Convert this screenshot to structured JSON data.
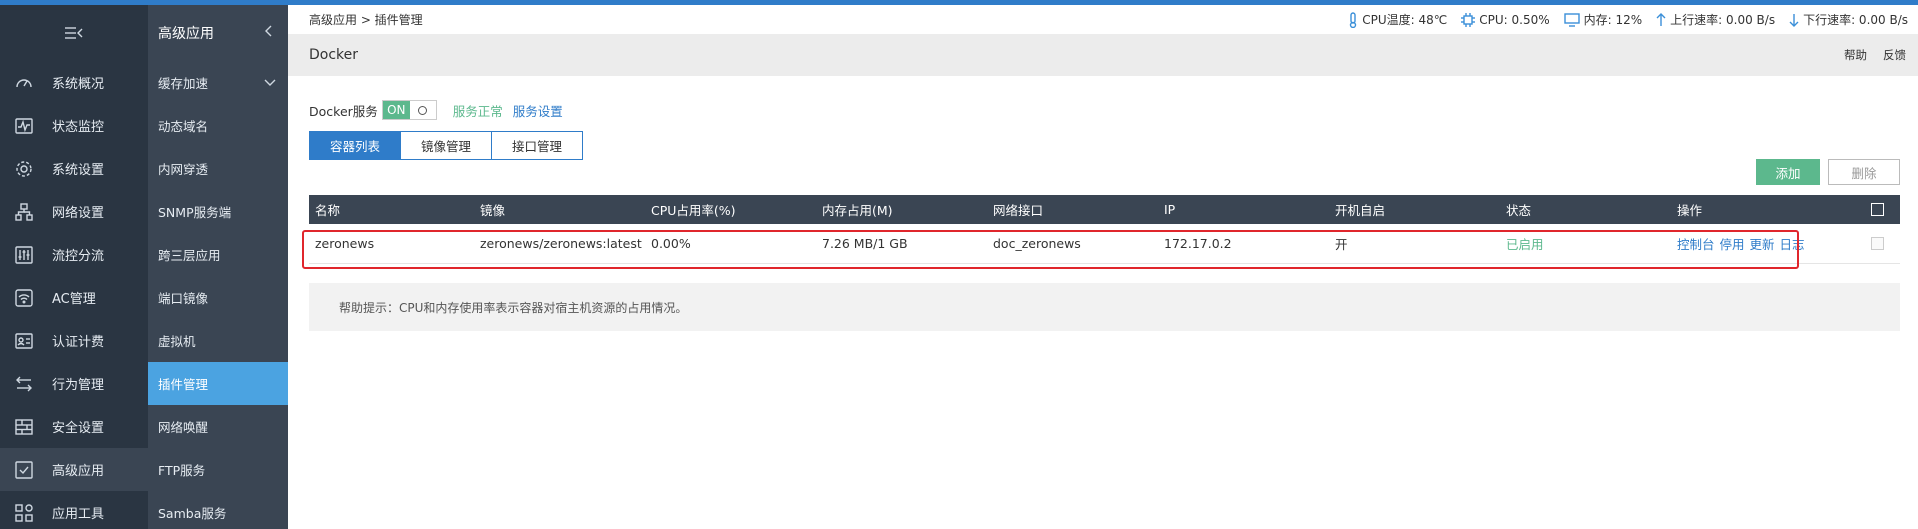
{
  "sidebar": {
    "items": [
      {
        "label": "系统概况",
        "icon": "dashboard-icon"
      },
      {
        "label": "状态监控",
        "icon": "monitor-wave-icon"
      },
      {
        "label": "系统设置",
        "icon": "gear-icon"
      },
      {
        "label": "网络设置",
        "icon": "network-icon"
      },
      {
        "label": "流控分流",
        "icon": "sliders-icon"
      },
      {
        "label": "AC管理",
        "icon": "wifi-icon"
      },
      {
        "label": "认证计费",
        "icon": "id-card-icon"
      },
      {
        "label": "行为管理",
        "icon": "arrows-swap-icon"
      },
      {
        "label": "安全设置",
        "icon": "firewall-icon"
      },
      {
        "label": "高级应用",
        "icon": "checkbox-icon"
      },
      {
        "label": "应用工具",
        "icon": "apps-icon"
      }
    ]
  },
  "submenu": {
    "title": "高级应用",
    "items": [
      {
        "label": "缓存加速"
      },
      {
        "label": "动态域名"
      },
      {
        "label": "内网穿透"
      },
      {
        "label": "SNMP服务端"
      },
      {
        "label": "跨三层应用"
      },
      {
        "label": "端口镜像"
      },
      {
        "label": "虚拟机"
      },
      {
        "label": "插件管理"
      },
      {
        "label": "网络唤醒"
      },
      {
        "label": "FTP服务"
      },
      {
        "label": "Samba服务"
      }
    ]
  },
  "breadcrumb": "高级应用 > 插件管理",
  "status": {
    "cpu_temp": "CPU温度: 48℃",
    "cpu": "CPU: 0.50%",
    "mem": "内存: 12%",
    "up": "上行速率: 0.00 B/s",
    "down": "下行速率: 0.00 B/s"
  },
  "page": {
    "title": "Docker",
    "help": "帮助",
    "feedback": "反馈"
  },
  "service": {
    "label": "Docker服务",
    "on_label": "ON",
    "status": "服务正常",
    "settings": "服务设置"
  },
  "tabs": [
    "容器列表",
    "镜像管理",
    "接口管理"
  ],
  "buttons": {
    "add": "添加",
    "delete": "删除"
  },
  "table": {
    "headers": [
      "名称",
      "镜像",
      "CPU占用率(%)",
      "内存占用(M)",
      "网络接口",
      "IP",
      "开机自启",
      "状态",
      "操作"
    ],
    "rows": [
      {
        "name": "zeronews",
        "image": "zeronews/zeronews:latest",
        "cpu": "0.00%",
        "mem": "7.26 MB/1 GB",
        "iface": "doc_zeronews",
        "ip": "172.17.0.2",
        "autostart": "开",
        "status": "已启用",
        "ops": [
          "控制台",
          "停用",
          "更新",
          "日志"
        ]
      }
    ]
  },
  "help_tip": "帮助提示：CPU和内存使用率表示容器对宿主机资源的占用情况。",
  "colors": {
    "accent": "#2f7cc9",
    "success": "#5cb88d",
    "sidebar": "#2a3542",
    "highlight": "#e0262c"
  }
}
